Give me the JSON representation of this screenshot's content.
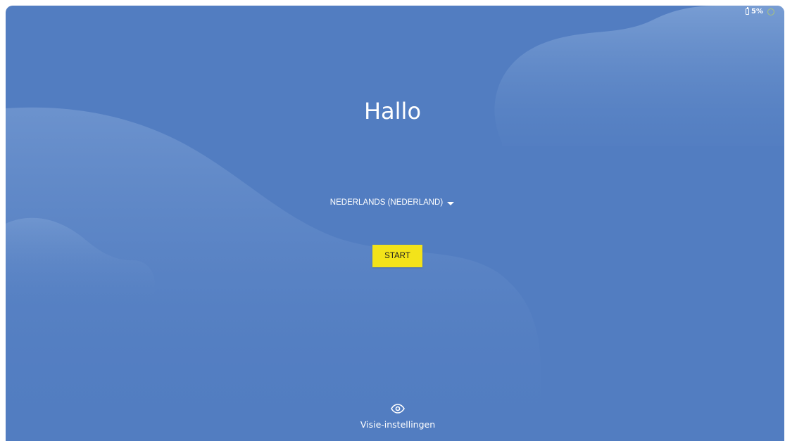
{
  "status_bar": {
    "battery_icon": "battery-icon",
    "battery_percent": "5%",
    "status_icon": "status-ring-icon"
  },
  "welcome": {
    "title": "Hallo"
  },
  "language_selector": {
    "selected_value": "NEDERLANDS (NEDERLAND)",
    "icon": "dropdown-caret-icon"
  },
  "start_button": {
    "label": "START",
    "color": "#f3e31a"
  },
  "vision_settings": {
    "icon": "eye-icon",
    "label": "Visie-instellingen"
  },
  "theme": {
    "background": "#527dc1",
    "wave_highlight": "#6e95cf",
    "text": "#ffffff"
  }
}
